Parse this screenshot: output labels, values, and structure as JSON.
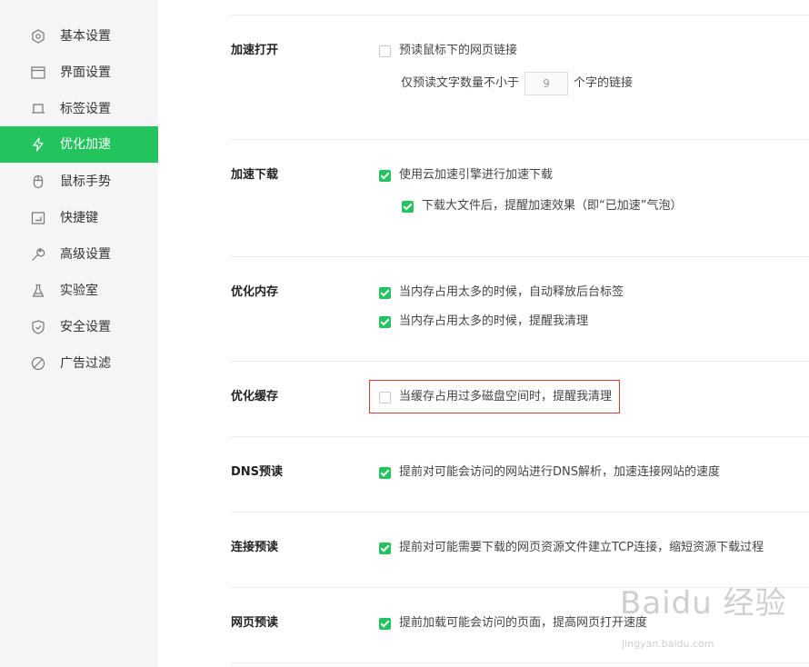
{
  "sidebar": {
    "items": [
      {
        "label": "基本设置",
        "icon": "hexagon-settings-icon"
      },
      {
        "label": "界面设置",
        "icon": "window-icon"
      },
      {
        "label": "标签设置",
        "icon": "tab-icon"
      },
      {
        "label": "优化加速",
        "icon": "lightning-icon",
        "active": true
      },
      {
        "label": "鼠标手势",
        "icon": "mouse-icon"
      },
      {
        "label": "快捷键",
        "icon": "keyboard-shortcut-icon"
      },
      {
        "label": "高级设置",
        "icon": "wrench-icon"
      },
      {
        "label": "实验室",
        "icon": "flask-icon"
      },
      {
        "label": "安全设置",
        "icon": "shield-icon"
      },
      {
        "label": "广告过滤",
        "icon": "block-icon"
      }
    ],
    "accent": "#23c45e"
  },
  "sections": {
    "speed_open": {
      "title": "加速打开",
      "opt1": "预读鼠标下的网页链接",
      "opt1_checked": false,
      "threshold_prefix": "仅预读文字数量不小于",
      "threshold_value": "9",
      "threshold_suffix": "个字的链接"
    },
    "speed_download": {
      "title": "加速下载",
      "opt1": "使用云加速引擎进行加速下载",
      "opt2": "下载大文件后，提醒加速效果（即“已加速”气泡）"
    },
    "memory": {
      "title": "优化内存",
      "opt1": "当内存占用太多的时候，自动释放后台标签",
      "opt2": "当内存占用太多的时候，提醒我清理"
    },
    "cache": {
      "title": "优化缓存",
      "opt1": "当缓存占用过多磁盘空间时，提醒我清理",
      "opt1_checked": false
    },
    "dns": {
      "title": "DNS预读",
      "opt1": "提前对可能会访问的网站进行DNS解析，加速连接网站的速度"
    },
    "connect": {
      "title": "连接预读",
      "opt1": "提前对可能需要下载的网页资源文件建立TCP连接，缩短资源下载过程"
    },
    "page": {
      "title": "网页预读",
      "opt1": "提前加载可能会访问的页面，提高网页打开速度"
    }
  },
  "watermark": {
    "big": "Baidu 经验",
    "small": "jingyan.baidu.com"
  }
}
